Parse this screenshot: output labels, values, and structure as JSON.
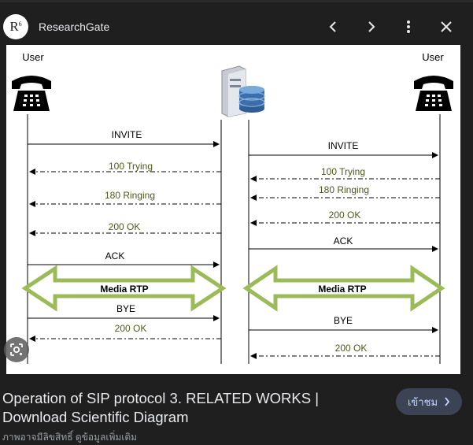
{
  "header": {
    "logo_text": "R",
    "logo_sup": "6",
    "site_name": "ResearchGate",
    "icons": [
      "chevron-left-icon",
      "chevron-right-icon",
      "more-vert-icon",
      "close-icon"
    ]
  },
  "figure": {
    "left_user": "User",
    "right_user": "User",
    "left_messages": [
      "INVITE",
      "100 Trying",
      "180 Ringing",
      "200 OK",
      "ACK",
      "Media RTP",
      "BYE",
      "200 OK"
    ],
    "right_messages": [
      "INVITE",
      "100 Trying",
      "180 Ringing",
      "200 OK",
      "ACK",
      "Media RTP",
      "BYE",
      "200 OK"
    ],
    "colors": {
      "request": "#000000",
      "response": "#4a5a1a",
      "media_arrow": "#9bbb59"
    }
  },
  "caption": "Operation of SIP protocol 3. RELATED WORKS | Download Scientific Diagram",
  "visit_button": "เข้าชม",
  "footnote": "ภาพอาจมีลิขสิทธิ์ ดูข้อมูลเพิ่มเติม"
}
